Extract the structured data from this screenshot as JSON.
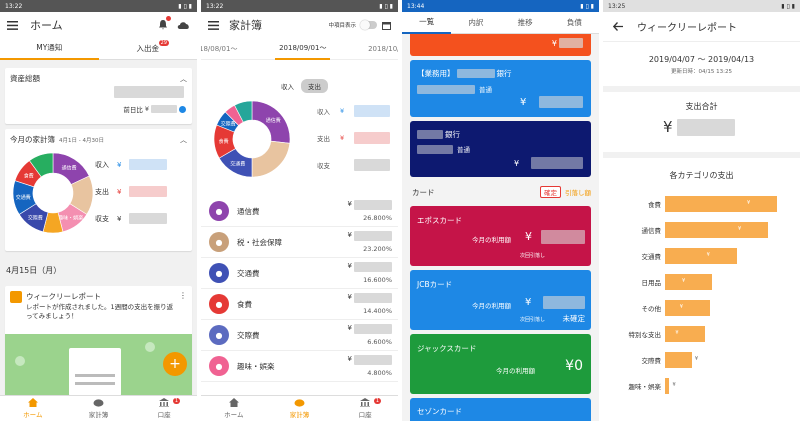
{
  "colors": {
    "accent": "#f39800",
    "blue": "#1565c0",
    "navy": "#0d1970",
    "red": "#c51448",
    "green": "#1e9b3c",
    "orange": "#f8ad50"
  },
  "s1": {
    "status_time": "13:22",
    "title": "ホーム",
    "tabs": [
      {
        "label": "MY通知"
      },
      {
        "label": "入出金",
        "badge": "29"
      }
    ],
    "assets": {
      "title": "資産総額",
      "prev_label": "前日比",
      "prev_suffix": "¥"
    },
    "budget": {
      "title": "今月の家計簿",
      "period": "4月1日 - 4月30日",
      "income": "収入",
      "expense": "支出",
      "balance": "収支",
      "yen": "¥",
      "legend": [
        "通信費",
        "交通費",
        "交際費",
        "食費",
        "趣味・娯楽",
        "税・社会保障"
      ]
    },
    "date": "4月15日（月）",
    "weekly": {
      "title": "ウィークリーレポート",
      "body": "レポートが作成されました。1週間の支出を振り返ってみましょう！"
    },
    "nav": [
      {
        "label": "ホーム"
      },
      {
        "label": "家計簿"
      },
      {
        "label": "口座",
        "badge": "1"
      }
    ]
  },
  "s2": {
    "status_time": "13:22",
    "title": "家計簿",
    "toggle_label": "中項目表示",
    "months": [
      "18/08/01〜",
      "2018/09/01〜",
      "2018/10/0"
    ],
    "segment": [
      "収入",
      "支出"
    ],
    "summary": [
      "収入",
      "支出",
      "収支"
    ],
    "yen": "¥",
    "legend": [
      "通信費",
      "食費",
      "交通費",
      "交際費"
    ],
    "categories": [
      {
        "name": "通信費",
        "pct": "26.800%"
      },
      {
        "name": "税・社会保障",
        "pct": "23.200%"
      },
      {
        "name": "交通費",
        "pct": "16.600%"
      },
      {
        "name": "食費",
        "pct": "14.400%"
      },
      {
        "name": "交際費",
        "pct": "6.600%"
      },
      {
        "name": "趣味・娯楽",
        "pct": "4.800%"
      }
    ],
    "nav": [
      {
        "label": "ホーム"
      },
      {
        "label": "家計簿"
      },
      {
        "label": "口座",
        "badge": "1"
      }
    ]
  },
  "s3": {
    "status_time": "13:44",
    "tabs": [
      "一覧",
      "内訳",
      "推移",
      "負債"
    ],
    "yen": "¥",
    "bank1": {
      "tag": "【業務用】",
      "bank": "銀行",
      "type": "普通"
    },
    "bank2": {
      "bank": "銀行",
      "type": "普通"
    },
    "card_header": "カード",
    "confirm": "確定",
    "withdraw": "引落し額",
    "cards": [
      {
        "name": "エポスカード",
        "usage": "今月の利用額",
        "next": "次回引落し"
      },
      {
        "name": "JCBカード",
        "usage": "今月の利用額",
        "next": "次回引落し",
        "status": "未確定"
      },
      {
        "name": "ジャックスカード",
        "usage": "今月の利用額",
        "amount": "¥0"
      },
      {
        "name": "セゾンカード"
      }
    ]
  },
  "s4": {
    "status_time": "13:25",
    "title": "ウィークリーレポート",
    "range": "2019/04/07 〜 2019/04/13",
    "updated": "更新日時：04/15 13:25",
    "total_title": "支出合計",
    "yen": "¥",
    "cat_title": "各カテゴリの支出"
  },
  "chart_data": {
    "type": "bar",
    "categories": [
      "食費",
      "通信費",
      "交通費",
      "日用品",
      "その他",
      "特別な支出",
      "交際費",
      "趣味・娯楽"
    ],
    "values": [
      100,
      92,
      64,
      42,
      40,
      36,
      24,
      4
    ],
    "xlabel": "",
    "ylabel": ""
  }
}
